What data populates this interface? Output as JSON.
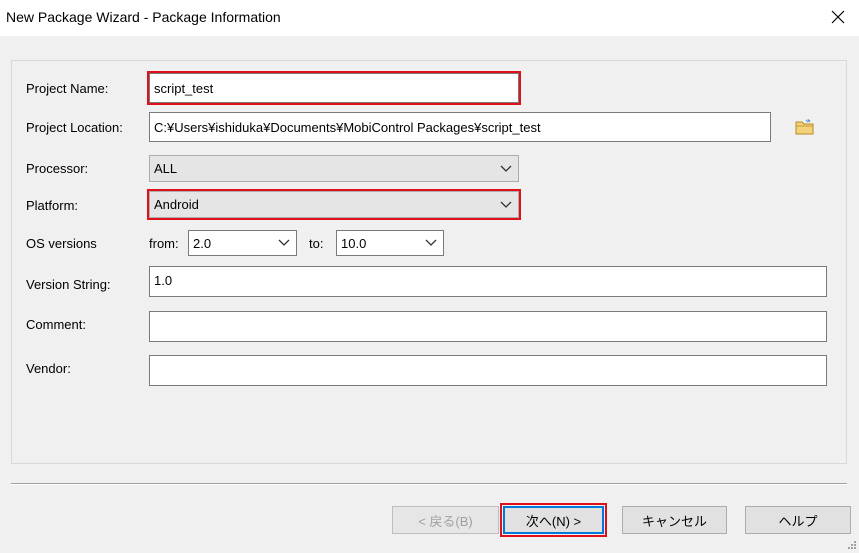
{
  "window": {
    "title": "New Package Wizard - Package Information",
    "close_icon": "close-icon"
  },
  "form": {
    "project_name": {
      "label": "Project Name:",
      "value": "script_test"
    },
    "project_location": {
      "label": "Project Location:",
      "value": "C:¥Users¥ishiduka¥Documents¥MobiControl Packages¥script_test",
      "browse_icon": "folder-browse-icon"
    },
    "processor": {
      "label": "Processor:",
      "value": "ALL"
    },
    "platform": {
      "label": "Platform:",
      "value": "Android"
    },
    "os_versions": {
      "label": "OS versions",
      "from_label": "from:",
      "from_value": "2.0",
      "to_label": "to:",
      "to_value": "10.0"
    },
    "version_string": {
      "label": "Version String:",
      "value": "1.0"
    },
    "comment": {
      "label": "Comment:",
      "value": ""
    },
    "vendor": {
      "label": "Vendor:",
      "value": ""
    }
  },
  "buttons": {
    "back": "< 戻る(B)",
    "next": "次へ(N) >",
    "cancel": "キャンセル",
    "help": "ヘルプ"
  },
  "colors": {
    "highlight": "#e0101a",
    "background": "#f0f0f0",
    "titlebar": "#ffffff"
  }
}
